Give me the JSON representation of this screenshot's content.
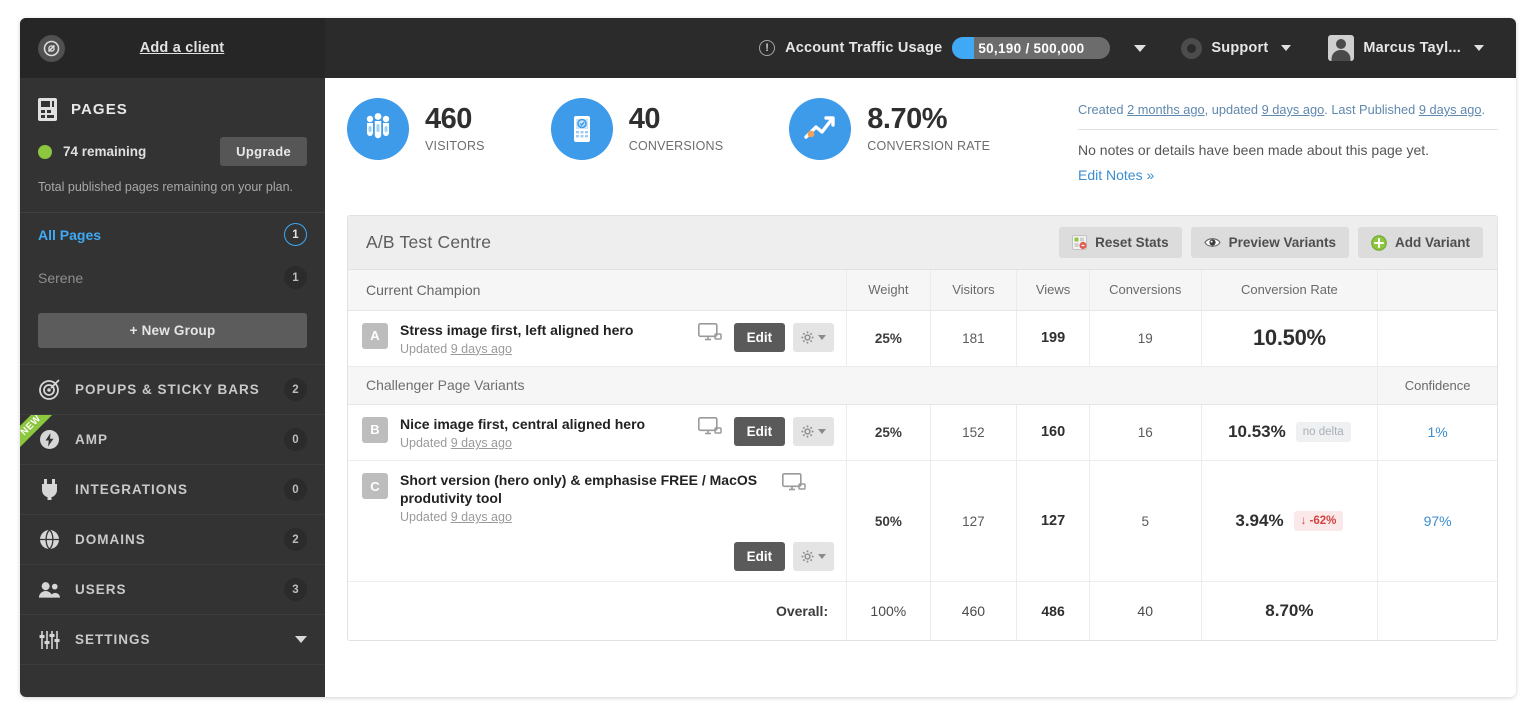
{
  "topbar": {
    "add_client": "Add a client",
    "traffic_label": "Account Traffic Usage",
    "traffic_value": "50,190 / 500,000",
    "support_label": "Support",
    "user_label": "Marcus Tayl...",
    "info_glyph": "!"
  },
  "sidebar": {
    "section_title": "PAGES",
    "remaining": "74 remaining",
    "upgrade": "Upgrade",
    "plan_note": "Total published pages remaining on your plan.",
    "pages": [
      {
        "label": "All Pages",
        "count": "1",
        "active": true
      },
      {
        "label": "Serene",
        "count": "1",
        "active": false
      }
    ],
    "new_group": "+ New Group",
    "sections": [
      {
        "label": "POPUPS & STICKY BARS",
        "count": "2",
        "icon": "target-icon",
        "ribbon": ""
      },
      {
        "label": "AMP",
        "count": "0",
        "icon": "bolt-icon",
        "ribbon": "NEW"
      },
      {
        "label": "INTEGRATIONS",
        "count": "0",
        "icon": "plug-icon",
        "ribbon": ""
      },
      {
        "label": "DOMAINS",
        "count": "2",
        "icon": "globe-icon",
        "ribbon": ""
      },
      {
        "label": "USERS",
        "count": "3",
        "icon": "users-icon",
        "ribbon": ""
      },
      {
        "label": "SETTINGS",
        "count": "",
        "icon": "sliders-icon",
        "ribbon": ""
      }
    ]
  },
  "stats": [
    {
      "value": "460",
      "label": "VISITORS",
      "icon": "visitors-icon"
    },
    {
      "value": "40",
      "label": "CONVERSIONS",
      "icon": "conversions-icon"
    },
    {
      "value": "8.70%",
      "label": "CONVERSION RATE",
      "icon": "conversion-rate-icon"
    }
  ],
  "notes": {
    "created_prefix": "Created ",
    "created_value": "2 months ago",
    "updated_prefix": ", updated ",
    "updated_value": "9 days ago",
    "published_prefix": ". Last Published ",
    "published_value": "9 days ago",
    "published_suffix": ".",
    "empty_text": "No notes or details have been made about this page yet.",
    "edit_link": "Edit Notes »"
  },
  "ab": {
    "title": "A/B Test Centre",
    "buttons": [
      {
        "label": "Reset Stats",
        "icon": "reset-stats-icon"
      },
      {
        "label": "Preview Variants",
        "icon": "eye-icon"
      },
      {
        "label": "Add Variant",
        "icon": "plus-circle-icon"
      }
    ],
    "columns": {
      "lead": "Current Champion",
      "weight": "Weight",
      "visitors": "Visitors",
      "views": "Views",
      "conversions": "Conversions",
      "conversion_rate": "Conversion Rate",
      "confidence": ""
    },
    "challenger_header": "Challenger Page Variants",
    "confidence_header": "Confidence",
    "edit_label": "Edit",
    "updated_prefix": "Updated ",
    "champion": {
      "letter": "A",
      "title": "Stress image first, left aligned hero",
      "updated": "9 days ago",
      "weight": "25%",
      "visitors": "181",
      "views": "199",
      "conversions": "19",
      "conversion_rate": "10.50%",
      "delta": "",
      "confidence": ""
    },
    "variants": [
      {
        "letter": "B",
        "title": "Nice image first, central aligned hero",
        "updated": "9 days ago",
        "weight": "25%",
        "visitors": "152",
        "views": "160",
        "conversions": "16",
        "conversion_rate": "10.53%",
        "delta": "no delta",
        "delta_type": "neutral",
        "confidence": "1%"
      },
      {
        "letter": "C",
        "title": "Short version (hero only) & emphasise FREE / MacOS produtivity tool",
        "updated": "9 days ago",
        "weight": "50%",
        "visitors": "127",
        "views": "127",
        "conversions": "5",
        "conversion_rate": "3.94%",
        "delta": "-62%",
        "delta_type": "down",
        "confidence": "97%"
      }
    ],
    "overall": {
      "label": "Overall:",
      "weight": "100%",
      "visitors": "460",
      "views": "486",
      "conversions": "40",
      "conversion_rate": "8.70%"
    }
  },
  "colors": {
    "accent_blue": "#3fa9f5",
    "link_blue": "#3b8dd0",
    "green": "#8dc63f",
    "red": "#d0433f",
    "sidebar_bg": "#333333",
    "topbar_bg": "#2b2b2b"
  }
}
